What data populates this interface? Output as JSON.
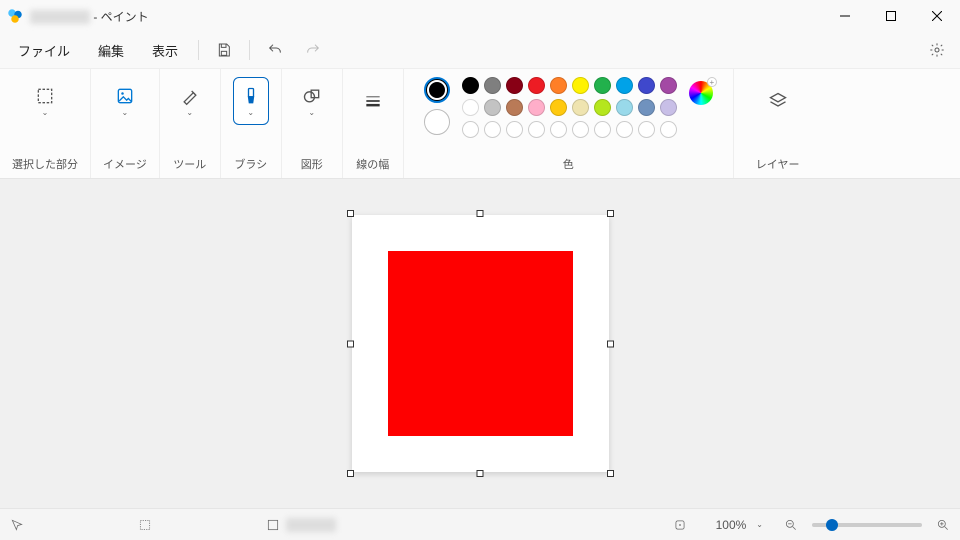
{
  "title_suffix": " - ペイント",
  "menu": {
    "file": "ファイル",
    "edit": "編集",
    "view": "表示"
  },
  "ribbon": {
    "selection": "選択した部分",
    "image": "イメージ",
    "tools": "ツール",
    "brushes": "ブラシ",
    "shapes": "図形",
    "stroke": "線の幅",
    "colors": "色",
    "layers": "レイヤー"
  },
  "palette": {
    "row1": [
      "#000000",
      "#7f7f7f",
      "#880015",
      "#ed1c24",
      "#ff7f27",
      "#fff200",
      "#22b14c",
      "#00a2e8",
      "#3f48cc",
      "#a349a4"
    ],
    "row2": [
      "#ffffff",
      "#c3c3c3",
      "#b97a57",
      "#ffaec9",
      "#ffc90e",
      "#efe4b0",
      "#b5e61d",
      "#99d9ea",
      "#7092be",
      "#c8bfe7"
    ]
  },
  "status": {
    "zoom": "100%"
  }
}
